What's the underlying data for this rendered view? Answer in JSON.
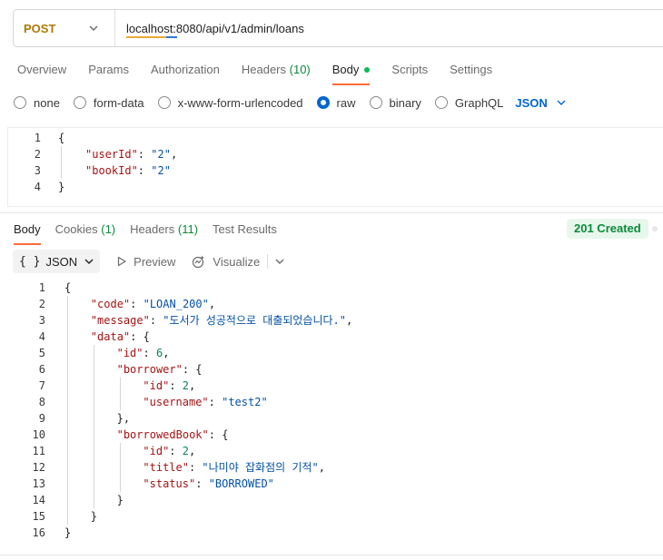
{
  "request": {
    "method": "POST",
    "url": "localhost:8080/api/v1/admin/loans",
    "tabs": [
      {
        "label": "Overview"
      },
      {
        "label": "Params"
      },
      {
        "label": "Authorization"
      },
      {
        "label": "Headers",
        "count": "(10)"
      },
      {
        "label": "Body",
        "active": true
      },
      {
        "label": "Scripts"
      },
      {
        "label": "Settings"
      }
    ],
    "body_types": [
      "none",
      "form-data",
      "x-www-form-urlencoded",
      "raw",
      "binary",
      "GraphQL"
    ],
    "selected_body_type": "raw",
    "format": "JSON",
    "body_lines": [
      {
        "n": "1",
        "text": "{"
      },
      {
        "n": "2",
        "key": "\"userId\"",
        "value": "\"2\"",
        "trail": ","
      },
      {
        "n": "3",
        "key": "\"bookId\"",
        "value": "\"2\"",
        "trail": ""
      },
      {
        "n": "4",
        "text": "}"
      }
    ]
  },
  "response": {
    "tabs": [
      {
        "label": "Body",
        "active": true
      },
      {
        "label": "Cookies",
        "count": "(1)"
      },
      {
        "label": "Headers",
        "count": "(11)"
      },
      {
        "label": "Test Results"
      }
    ],
    "status": "201 Created",
    "format_label": "JSON",
    "format_braces": "{ }",
    "preview_label": "Preview",
    "visualize_label": "Visualize",
    "lines": [
      {
        "n": "1",
        "indent": 0,
        "parts": [
          [
            "pun",
            "{"
          ]
        ]
      },
      {
        "n": "2",
        "indent": 1,
        "parts": [
          [
            "key",
            "\"code\""
          ],
          [
            "pun",
            ": "
          ],
          [
            "str",
            "\"LOAN_200\""
          ],
          [
            "pun",
            ","
          ]
        ]
      },
      {
        "n": "3",
        "indent": 1,
        "parts": [
          [
            "key",
            "\"message\""
          ],
          [
            "pun",
            ": "
          ],
          [
            "str",
            "\"도서가 성공적으로 대출되었습니다.\""
          ],
          [
            "pun",
            ","
          ]
        ]
      },
      {
        "n": "4",
        "indent": 1,
        "parts": [
          [
            "key",
            "\"data\""
          ],
          [
            "pun",
            ": {"
          ]
        ]
      },
      {
        "n": "5",
        "indent": 2,
        "parts": [
          [
            "key",
            "\"id\""
          ],
          [
            "pun",
            ": "
          ],
          [
            "num",
            "6"
          ],
          [
            "pun",
            ","
          ]
        ]
      },
      {
        "n": "6",
        "indent": 2,
        "parts": [
          [
            "key",
            "\"borrower\""
          ],
          [
            "pun",
            ": {"
          ]
        ]
      },
      {
        "n": "7",
        "indent": 3,
        "parts": [
          [
            "key",
            "\"id\""
          ],
          [
            "pun",
            ": "
          ],
          [
            "num",
            "2"
          ],
          [
            "pun",
            ","
          ]
        ]
      },
      {
        "n": "8",
        "indent": 3,
        "parts": [
          [
            "key",
            "\"username\""
          ],
          [
            "pun",
            ": "
          ],
          [
            "str",
            "\"test2\""
          ]
        ]
      },
      {
        "n": "9",
        "indent": 2,
        "parts": [
          [
            "pun",
            "},"
          ]
        ]
      },
      {
        "n": "10",
        "indent": 2,
        "parts": [
          [
            "key",
            "\"borrowedBook\""
          ],
          [
            "pun",
            ": {"
          ]
        ]
      },
      {
        "n": "11",
        "indent": 3,
        "parts": [
          [
            "key",
            "\"id\""
          ],
          [
            "pun",
            ": "
          ],
          [
            "num",
            "2"
          ],
          [
            "pun",
            ","
          ]
        ]
      },
      {
        "n": "12",
        "indent": 3,
        "parts": [
          [
            "key",
            "\"title\""
          ],
          [
            "pun",
            ": "
          ],
          [
            "str",
            "\"나미야 잡화점의 기적\""
          ],
          [
            "pun",
            ","
          ]
        ]
      },
      {
        "n": "13",
        "indent": 3,
        "parts": [
          [
            "key",
            "\"status\""
          ],
          [
            "pun",
            ": "
          ],
          [
            "str",
            "\"BORROWED\""
          ]
        ]
      },
      {
        "n": "14",
        "indent": 2,
        "parts": [
          [
            "pun",
            "}"
          ]
        ]
      },
      {
        "n": "15",
        "indent": 1,
        "parts": [
          [
            "pun",
            "}"
          ]
        ]
      },
      {
        "n": "16",
        "indent": 0,
        "parts": [
          [
            "pun",
            "}"
          ]
        ]
      }
    ]
  },
  "colors": {
    "method": "#ad7a03",
    "accent": "#ff6c37",
    "link": "#0265d2",
    "success": "#0b8a3a",
    "json_key": "#a31515",
    "json_string": "#0451a5",
    "json_number": "#098658"
  },
  "icons": [
    "chevron-down-icon",
    "play-icon",
    "visualize-icon",
    "radio-selected-icon"
  ]
}
